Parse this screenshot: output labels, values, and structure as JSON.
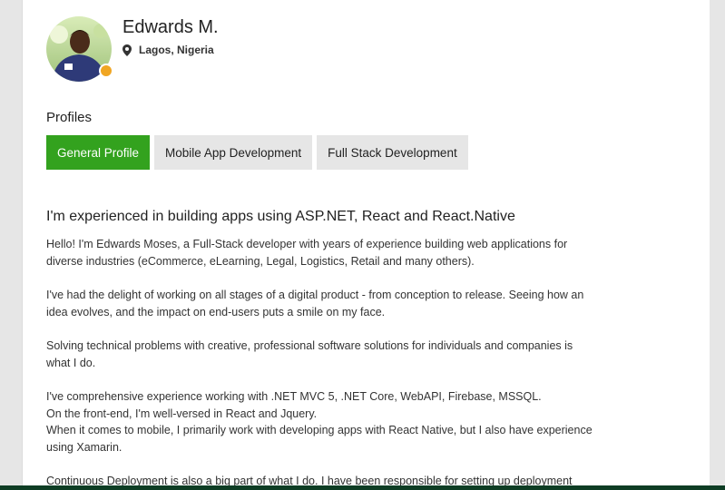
{
  "profile": {
    "name": "Edwards M.",
    "location": "Lagos, Nigeria",
    "status_color": "#f0a623"
  },
  "profiles_section": {
    "heading": "Profiles",
    "tabs": [
      {
        "label": "General Profile",
        "active": true
      },
      {
        "label": "Mobile App Development",
        "active": false
      },
      {
        "label": "Full Stack Development",
        "active": false
      }
    ]
  },
  "content": {
    "headline": "I'm experienced in building apps using ASP.NET, React and React.Native",
    "paragraphs": [
      "Hello! I'm Edwards Moses, a Full-Stack developer with years of experience building web applications for\ndiverse industries (eCommerce, eLearning, Legal, Logistics, Retail and many others).",
      "I've had the delight of working on all stages of a digital product - from conception to release. Seeing how an\nidea evolves, and the impact on end-users puts a smile on my face.",
      "Solving technical problems with creative, professional software solutions for individuals and companies is\nwhat I do.",
      "I've comprehensive experience working with .NET MVC 5, .NET Core, WebAPI, Firebase, MSSQL.\nOn the front-end, I'm well-versed in React and Jquery.\nWhen it comes to mobile, I primarily work with developing apps with React Native, but I also have experience\nusing Xamarin.",
      "Continuous Deployment is also a big part of what I do. I have been responsible for setting up deployment"
    ]
  },
  "colors": {
    "accent": "#33a21e",
    "tab_inactive": "#e6e6e6",
    "background": "#e6e6e6"
  },
  "icons": {
    "location": "map-pin-icon"
  }
}
